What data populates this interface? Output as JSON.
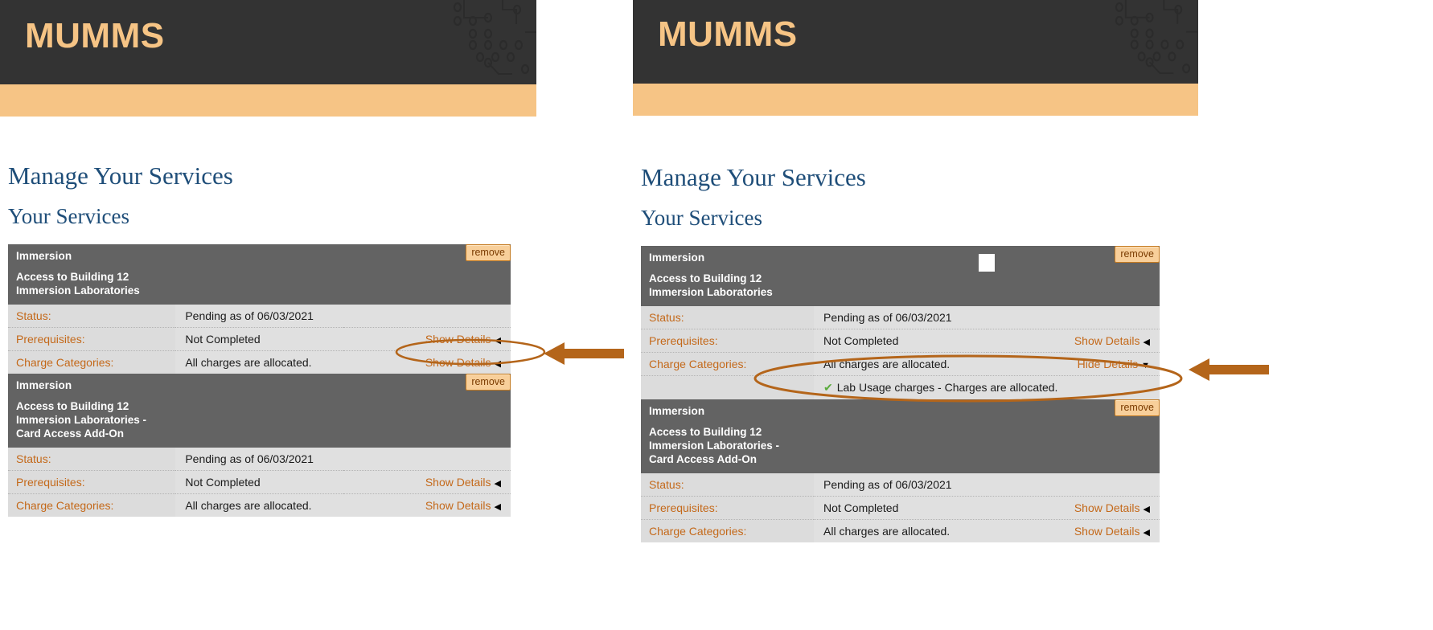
{
  "brand": {
    "logo_text": "MUMMS",
    "header_bg": "#333333",
    "accent_bar": "#f6c485",
    "logo_color": "#f6c485"
  },
  "colors": {
    "heading": "#1f4e79",
    "label_orange": "#c4691a",
    "row_header_bg": "#636363",
    "annotation": "#b4651a",
    "check_green": "#5aab3c"
  },
  "icons": {
    "collapsed_triangle": "◀",
    "expanded_triangle": "▼",
    "check": "✔"
  },
  "page": {
    "title": "Manage Your Services",
    "section": "Your Services"
  },
  "left_panel": {
    "title": "Manage Your Services",
    "section": "Your Services",
    "services": [
      {
        "category": "Immersion",
        "name": "Access to Building 12\nImmersion Laboratories",
        "name_line1": "Access to Building 12",
        "name_line2": "Immersion Laboratories",
        "name_line3": "",
        "remove_label": "remove",
        "rows": [
          {
            "label": "Status:",
            "value": "Pending as of 06/03/2021",
            "link": "",
            "tri": ""
          },
          {
            "label": "Prerequisites:",
            "value": "Not Completed",
            "link": "Show Details",
            "tri": "◀"
          },
          {
            "label": "Charge Categories:",
            "value": "All charges are allocated.",
            "link": "Show Details",
            "tri": "◀"
          }
        ]
      },
      {
        "category": "Immersion",
        "name_line1": "Access to Building 12",
        "name_line2": "Immersion Laboratories -",
        "name_line3": "Card Access Add-On",
        "remove_label": "remove",
        "rows": [
          {
            "label": "Status:",
            "value": "Pending as of 06/03/2021",
            "link": "",
            "tri": ""
          },
          {
            "label": "Prerequisites:",
            "value": "Not Completed",
            "link": "Show Details",
            "tri": "◀"
          },
          {
            "label": "Charge Categories:",
            "value": "All charges are allocated.",
            "link": "Show Details",
            "tri": "◀"
          }
        ]
      }
    ]
  },
  "right_panel": {
    "title": "Manage Your Services",
    "section": "Your Services",
    "services": [
      {
        "category": "Immersion",
        "name_line1": "Access to Building 12",
        "name_line2": "Immersion Laboratories",
        "name_line3": "",
        "remove_label": "remove",
        "rows": [
          {
            "label": "Status:",
            "value": "Pending as of 06/03/2021",
            "link": "",
            "tri": ""
          },
          {
            "label": "Prerequisites:",
            "value": "Not Completed",
            "link": "Show Details",
            "tri": "◀"
          },
          {
            "label": "Charge Categories:",
            "value": "All charges are allocated.",
            "link": "Hide Details",
            "tri": "▼"
          }
        ],
        "expanded_detail": "Lab Usage charges - Charges are allocated."
      },
      {
        "category": "Immersion",
        "name_line1": "Access to Building 12",
        "name_line2": "Immersion Laboratories -",
        "name_line3": "Card Access Add-On",
        "remove_label": "remove",
        "rows": [
          {
            "label": "Status:",
            "value": "Pending as of 06/03/2021",
            "link": "",
            "tri": ""
          },
          {
            "label": "Prerequisites:",
            "value": "Not Completed",
            "link": "Show Details",
            "tri": "◀"
          },
          {
            "label": "Charge Categories:",
            "value": "All charges are allocated.",
            "link": "Show Details",
            "tri": "◀"
          }
        ]
      }
    ]
  }
}
